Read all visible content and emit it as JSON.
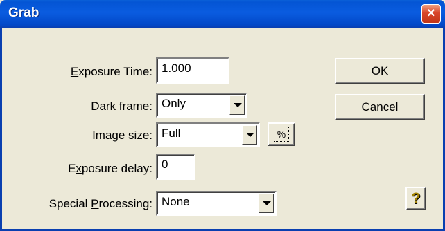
{
  "window": {
    "title": "Grab",
    "close_icon": "×"
  },
  "form": {
    "exposure_time": {
      "label_pre": "",
      "label_u": "E",
      "label_post": "xposure Time:",
      "value": "1.000"
    },
    "dark_frame": {
      "label_pre": "",
      "label_u": "D",
      "label_post": "ark frame:",
      "value": "Only"
    },
    "image_size": {
      "label_pre": "",
      "label_u": "I",
      "label_post": "mage size:",
      "value": "Full",
      "extra_icon": "%"
    },
    "exposure_delay": {
      "label_pre": "E",
      "label_u": "x",
      "label_post": "posure delay:",
      "value": "0"
    },
    "special_processing": {
      "label_pre": "Special ",
      "label_u": "P",
      "label_post": "rocessing:",
      "value": "None"
    }
  },
  "buttons": {
    "ok": "OK",
    "cancel": "Cancel",
    "help_icon": "?"
  }
}
